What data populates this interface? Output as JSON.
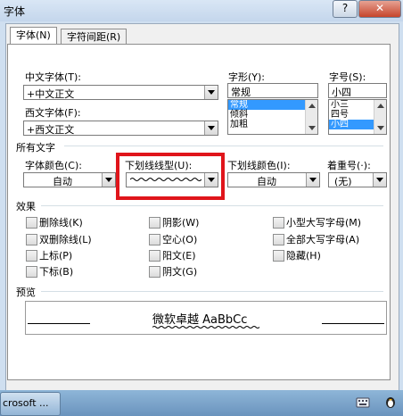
{
  "window": {
    "title": "字体",
    "help_label": "?",
    "close_label": "✕"
  },
  "tabs": [
    {
      "label": "字体(N)",
      "active": true
    },
    {
      "label": "字符间距(R)",
      "active": false
    }
  ],
  "font": {
    "chinese_font_label": "中文字体(T):",
    "chinese_font_value": "+中文正文",
    "western_font_label": "西文字体(F):",
    "western_font_value": "+西文正文",
    "style_label": "字形(Y):",
    "style_value": "常规",
    "style_options": [
      "常规",
      "倾斜",
      "加粗"
    ],
    "size_label": "字号(S):",
    "size_value": "小四",
    "size_options": [
      "小三",
      "四号",
      "小四"
    ]
  },
  "all_text": {
    "group_label": "所有文字",
    "font_color_label": "字体颜色(C):",
    "font_color_value": "自动",
    "underline_style_label": "下划线线型(U):",
    "underline_color_label": "下划线颜色(I):",
    "underline_color_value": "自动",
    "emphasis_label": "着重号(·):",
    "emphasis_value": "(无)"
  },
  "effects": {
    "group_label": "效果",
    "items": [
      "删除线(K)",
      "双删除线(L)",
      "上标(P)",
      "下标(B)",
      "阴影(W)",
      "空心(O)",
      "阳文(E)",
      "阴文(G)",
      "小型大写字母(M)",
      "全部大写字母(A)",
      "隐藏(H)"
    ]
  },
  "preview": {
    "group_label": "预览",
    "text": "微软卓越 AaBbCc"
  },
  "taskbar": {
    "item_label": "crosoft ..."
  },
  "colors": {
    "highlight": "#e0151b",
    "selection": "#3399ff"
  }
}
